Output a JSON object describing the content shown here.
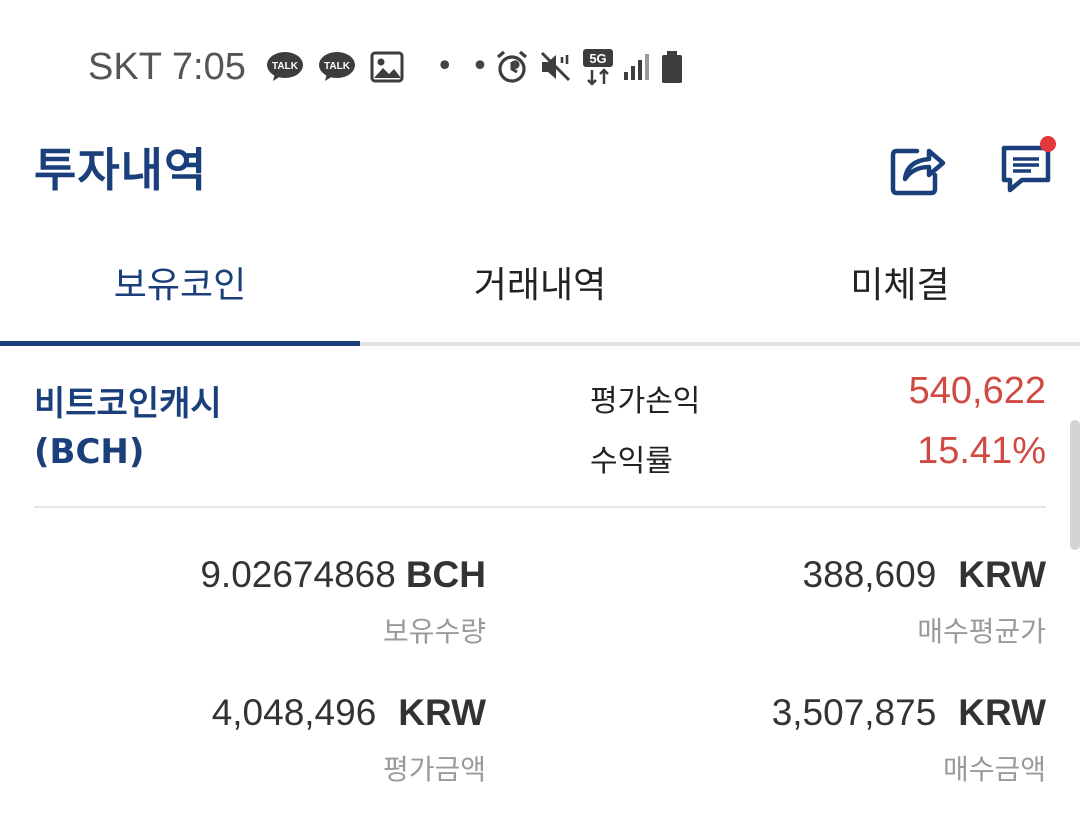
{
  "status_bar": {
    "carrier": "SKT",
    "time": "7:05",
    "left_icons": [
      "kakaotalk-icon",
      "kakaotalk-icon",
      "gallery-icon"
    ],
    "more": "• • •",
    "talk_label": "TALK",
    "network_label": "5G",
    "right_icons": [
      "alarm-icon",
      "mute-icon",
      "5g-data-icon",
      "signal-icon",
      "battery-icon"
    ]
  },
  "header": {
    "title": "투자내역",
    "icons": [
      "share-icon",
      "chat-notice-icon"
    ],
    "accent_color": "#1a3f7a",
    "badge_color": "#e5383b"
  },
  "tabs": [
    {
      "label": "보유코인",
      "active": true
    },
    {
      "label": "거래내역",
      "active": false
    },
    {
      "label": "미체결",
      "active": false
    }
  ],
  "holding": {
    "coin_name": "비트코인캐시",
    "coin_symbol": "(BCH)",
    "eval_pl_label": "평가손익",
    "eval_pl_value": "540,622",
    "return_label": "수익률",
    "return_value": "15.41%",
    "positive_color": "#d04a43",
    "quantity": {
      "value": "9.02674868",
      "unit": "BCH",
      "label": "보유수량"
    },
    "avg_price": {
      "value": "388,609",
      "unit": "KRW",
      "label": "매수평균가"
    },
    "eval_amount": {
      "value": "4,048,496",
      "unit": "KRW",
      "label": "평가금액"
    },
    "buy_amount": {
      "value": "3,507,875",
      "unit": "KRW",
      "label": "매수금액"
    }
  }
}
